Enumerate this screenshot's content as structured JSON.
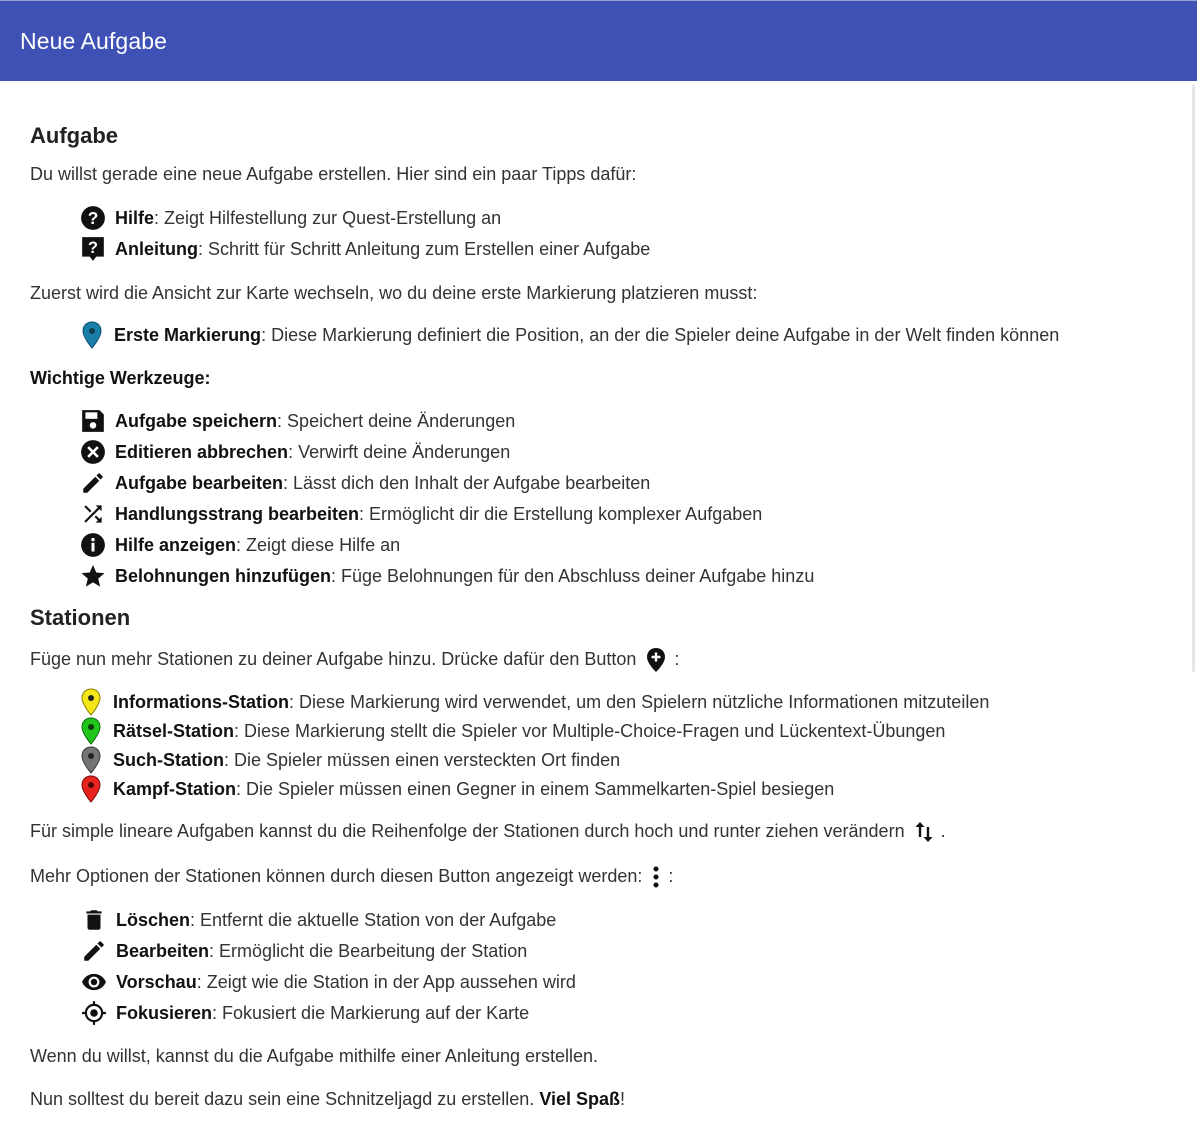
{
  "dialog": {
    "title": "Neue Aufgabe"
  },
  "aufgabe": {
    "heading": "Aufgabe",
    "intro": "Du willst gerade eine neue Aufgabe erstellen. Hier sind ein paar Tipps dafür:",
    "help_items": [
      {
        "icon": "help-circle-icon",
        "label": "Hilfe",
        "desc": ": Zeigt Hilfestellung zur Quest-Erstellung an"
      },
      {
        "icon": "help-bubble-icon",
        "label": "Anleitung",
        "desc": ": Schritt für Schritt Anleitung zum Erstellen einer Aufgabe"
      }
    ],
    "map_intro": "Zuerst wird die Ansicht zur Karte wechseln, wo du deine erste Markierung platzieren musst:",
    "marker_item": {
      "icon": "blue-marker-icon",
      "label": "Erste Markierung",
      "desc": ": Diese Markierung definiert die Position, an der die Spieler deine Aufgabe in der Welt finden können"
    },
    "tools_heading": "Wichtige Werkzeuge:",
    "tools": [
      {
        "icon": "save-icon",
        "label": "Aufgabe speichern",
        "desc": ": Speichert deine Änderungen"
      },
      {
        "icon": "cancel-circle-icon",
        "label": "Editieren abbrechen",
        "desc": ": Verwirft deine Änderungen"
      },
      {
        "icon": "pencil-icon",
        "label": "Aufgabe bearbeiten",
        "desc": ": Lässt dich den Inhalt der Aufgabe bearbeiten"
      },
      {
        "icon": "shuffle-icon",
        "label": "Handlungsstrang bearbeiten",
        "desc": ": Ermöglicht dir die Erstellung komplexer Aufgaben"
      },
      {
        "icon": "info-icon",
        "label": "Hilfe anzeigen",
        "desc": ": Zeigt diese Hilfe an"
      },
      {
        "icon": "star-icon",
        "label": "Belohnungen hinzufügen",
        "desc": ": Füge Belohnungen für den Abschluss deiner Aufgabe hinzu"
      }
    ]
  },
  "stationen": {
    "heading": "Stationen",
    "intro_before": "Füge nun mehr Stationen zu deiner Aufgabe hinzu. Drücke dafür den Button",
    "intro_after": ":",
    "intro_icon": "add-location-icon",
    "types": [
      {
        "icon": "yellow-marker-icon",
        "color": "#f5e61a",
        "label": "Informations-Station",
        "desc": ": Diese Markierung wird verwendet, um den Spielern nützliche Informationen mitzuteilen"
      },
      {
        "icon": "green-marker-icon",
        "color": "#22c51c",
        "label": "Rätsel-Station",
        "desc": ": Diese Markierung stellt die Spieler vor Multiple-Choice-Fragen und Lückentext-Übungen"
      },
      {
        "icon": "gray-marker-icon",
        "color": "#757575",
        "label": "Such-Station",
        "desc": ": Die Spieler müssen einen versteckten Ort finden"
      },
      {
        "icon": "red-marker-icon",
        "color": "#e8231f",
        "label": "Kampf-Station",
        "desc": ": Die Spieler müssen einen Gegner in einem Sammelkarten-Spiel besiegen"
      }
    ],
    "reorder_before": "Für simple lineare Aufgaben kannst du die Reihenfolge der Stationen durch hoch und runter ziehen verändern",
    "reorder_after": ".",
    "reorder_icon": "swap-vertical-icon",
    "options_before": "Mehr Optionen der Stationen können durch diesen Button angezeigt werden:",
    "options_after": ":",
    "options_icon": "more-vert-icon",
    "options": [
      {
        "icon": "trash-icon",
        "label": "Löschen",
        "desc": ": Entfernt die aktuelle Station von der Aufgabe"
      },
      {
        "icon": "pencil-icon",
        "label": "Bearbeiten",
        "desc": ": Ermöglicht die Bearbeitung der Station"
      },
      {
        "icon": "eye-icon",
        "label": "Vorschau",
        "desc": ": Zeigt wie die Station in der App aussehen wird"
      },
      {
        "icon": "gps-target-icon",
        "label": "Fokusieren",
        "desc": ": Fokusiert die Markierung auf der Karte"
      }
    ],
    "guide_text": "Wenn du willst, kannst du die Aufgabe mithilfe einer Anleitung erstellen.",
    "final_before": "Nun solltest du bereit dazu sein eine Schnitzeljagd zu erstellen.",
    "final_bold": "Viel Spaß",
    "final_after": "!"
  },
  "colors": {
    "header": "#3f51b5",
    "first_marker": "#1a7fa8"
  }
}
